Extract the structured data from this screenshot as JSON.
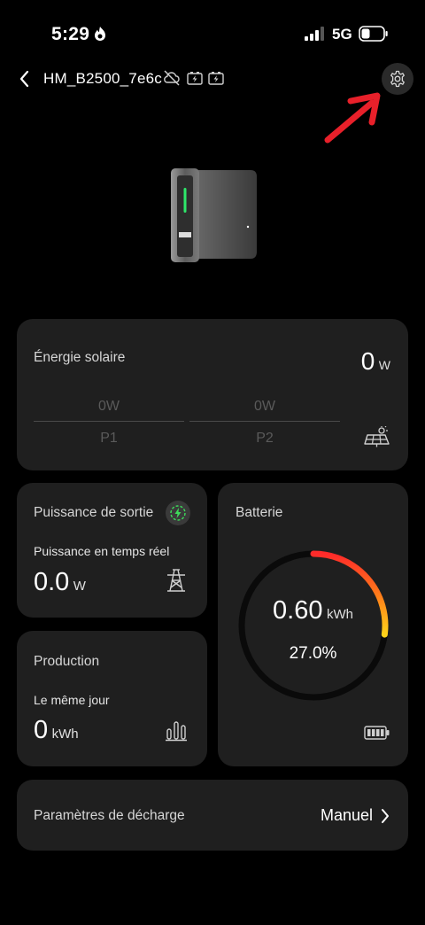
{
  "status_bar": {
    "time": "5:29",
    "network": "5G"
  },
  "header": {
    "device_name": "HM_B2500_7e6c"
  },
  "solar": {
    "title": "Énergie solaire",
    "power_value": "0",
    "power_unit": "W",
    "p1_value": "0W",
    "p1_label": "P1",
    "p2_value": "0W",
    "p2_label": "P2"
  },
  "output": {
    "title": "Puissance de sortie",
    "realtime_label": "Puissance en temps réel",
    "value": "0.0",
    "unit": "W"
  },
  "production": {
    "title": "Production",
    "day_label": "Le même jour",
    "value": "0",
    "unit": "kWh"
  },
  "battery": {
    "title": "Batterie",
    "energy_value": "0.60",
    "energy_unit": "kWh",
    "percent_text": "27.0%",
    "level_fraction": 0.27,
    "gauge_colors": [
      "#ff2a2a",
      "#ff7a1a",
      "#ffd21a"
    ]
  },
  "discharge": {
    "title": "Paramètres de décharge",
    "mode": "Manuel"
  },
  "colors": {
    "background": "#000000",
    "card": "#1f1f1f",
    "annotation_arrow": "#e8202a"
  }
}
